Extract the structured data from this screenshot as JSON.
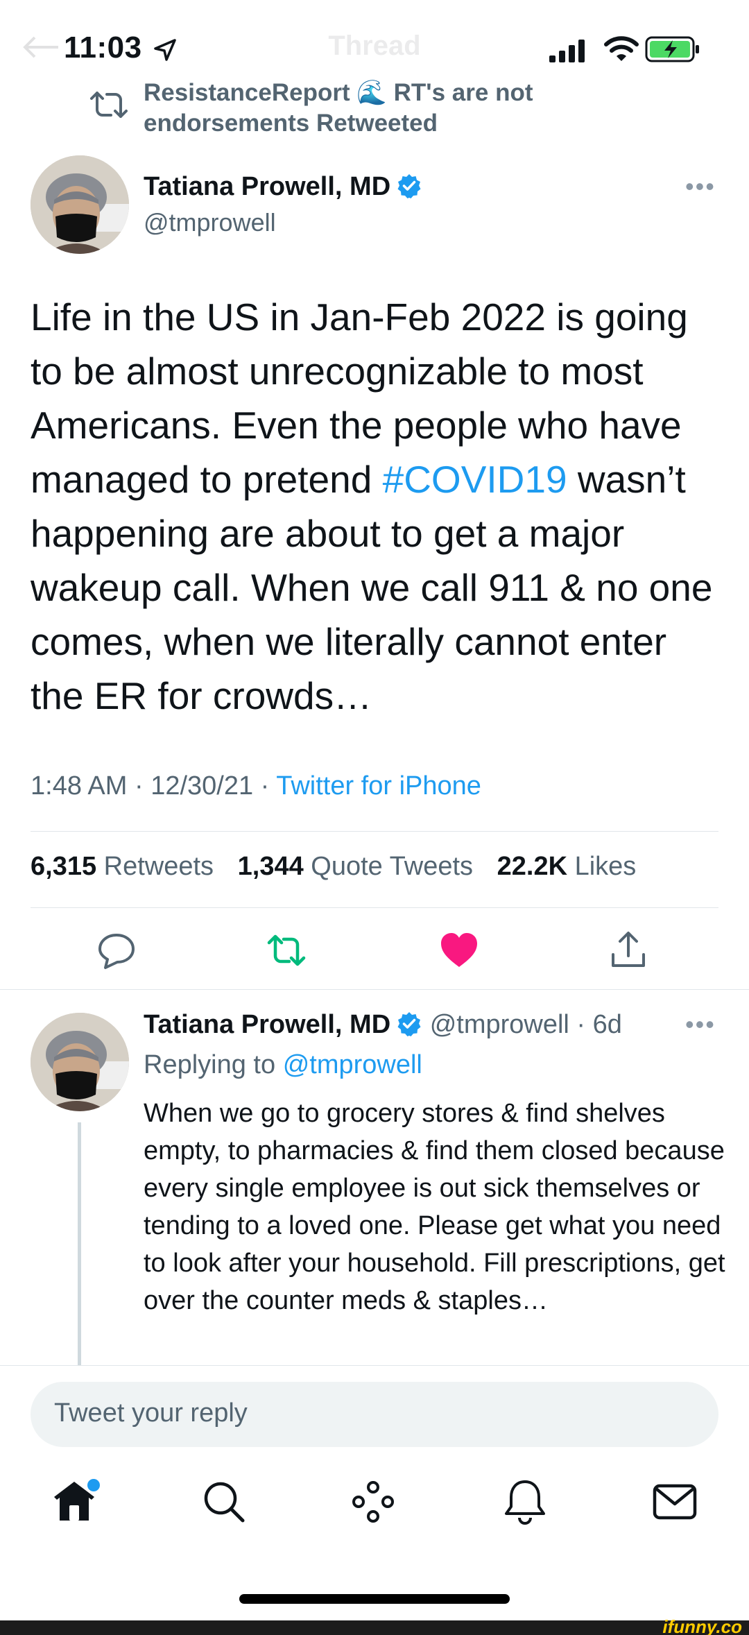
{
  "status_bar": {
    "time": "11:03",
    "ghost_title": "Thread"
  },
  "retweet_context": {
    "text": "ResistanceReport 🌊 RT's are not endorsements Retweeted"
  },
  "main_tweet": {
    "author_name": "Tatiana Prowell, MD",
    "author_handle": "@tmprowell",
    "body_before": "Life in the US in Jan-Feb 2022 is going to be almost unrecognizable to most Americans. Even the people who have managed to pretend ",
    "hashtag": "#COVID19",
    "body_after": " wasn’t happening are about to get a major wakeup call. When we call 911 & no one comes, when we literally cannot enter the ER for crowds…",
    "time": "1:48 AM",
    "date": "12/30/21",
    "source": "Twitter for iPhone",
    "separator": " · "
  },
  "stats": {
    "retweets_count": "6,315",
    "retweets_label": "Retweets",
    "quotes_count": "1,344",
    "quotes_label": "Quote Tweets",
    "likes_count": "22.2K",
    "likes_label": "Likes"
  },
  "reply_tweet": {
    "author_name": "Tatiana Prowell, MD",
    "author_handle": "@tmprowell",
    "age": "6d",
    "replying_to_label": "Replying to",
    "replying_to_mention": "@tmprowell",
    "body": "When we go to grocery stores & find shelves empty, to pharmacies & find them closed because every single employee is out sick themselves or tending to a loved one. Please get what you need to look after your household. Fill prescriptions, get over the counter meds & staples…"
  },
  "composer": {
    "placeholder": "Tweet your reply"
  },
  "watermark": "ifunny.co",
  "colors": {
    "accent": "#1d9bf0",
    "retweet_green": "#00ba7c",
    "like_pink": "#f91880",
    "secondary_text": "#536471"
  },
  "icons": {
    "retweet": "retweet-icon",
    "verified": "verified-badge-icon",
    "reply": "reply-icon",
    "like": "heart-icon",
    "share": "share-icon",
    "home": "home-icon",
    "search": "search-icon",
    "spaces": "spaces-icon",
    "notifications": "bell-icon",
    "messages": "envelope-icon"
  }
}
